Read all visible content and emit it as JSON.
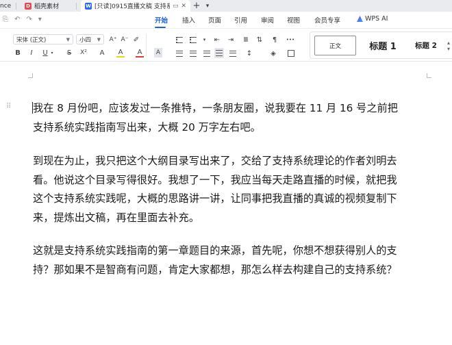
{
  "tabs": [
    {
      "label": "nce",
      "kind": "truncated"
    },
    {
      "label": "稻壳素材",
      "kind": "docer"
    },
    {
      "label": "[只读]0915直播文稿 支持系",
      "kind": "document",
      "active": true
    }
  ],
  "tab_actions": {
    "new_tab": "+",
    "menu": "▾"
  },
  "quick_access": [
    "⎘",
    "↶",
    "↷",
    "▾"
  ],
  "menu": {
    "items": [
      "开始",
      "插入",
      "页面",
      "引用",
      "审阅",
      "视图",
      "会员专享",
      "WPS AI"
    ],
    "active": "开始"
  },
  "toolbar": {
    "font_name": "宋体 (正文)",
    "font_size": "小四",
    "bold": "B",
    "italic": "I",
    "underline": "U",
    "strikethrough": "S",
    "superscript": "X²",
    "text_effect": "A",
    "highlight": "A",
    "font_color": "A",
    "char_shading": "A",
    "grow": "A⁺",
    "shrink": "A⁻",
    "clear": "✐",
    "accent_color": "#1e63e0",
    "highlight_color": "#f3d400",
    "font_color_value": "#e53935"
  },
  "styles": {
    "normal": "正文",
    "heading1": "标题 1",
    "heading2": "标题 2"
  },
  "document": {
    "paragraphs": [
      [
        "我在 8 月份吧，应该发过一条推特，一条朋友圈，说我要在 11 月 16 号之前把",
        "支持系统实践指南写出来，大概 20 万字左右吧。"
      ],
      [
        "到现在为止，我只把这个大纲目录写出来了，交给了支持系统理论的作者刘明去",
        "看。他说这个目录写得很好。我想了一下，我应当每天走路直播的时候，就把我",
        "这个支持系统实践呢，大概的思路讲一讲，让同事把我直播的真诚的视频复制下",
        "来，提炼出文稿，再在里面去补充。"
      ],
      [
        "这就是支持系统实践指南的第一章题目的来源，首先呢，你想不想获得别人的支",
        "持？那如果不是智商有问题，肯定大家都想，那怎么样去构建自己的支持系统？"
      ]
    ]
  }
}
